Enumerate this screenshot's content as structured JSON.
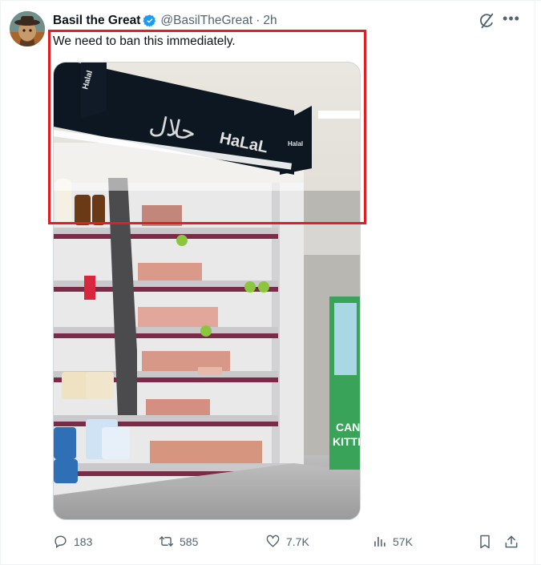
{
  "tweet": {
    "author_name": "Basil the Great",
    "handle": "@BasilTheGreat",
    "separator": "·",
    "time": "2h",
    "text": "We need to ban this immediately.",
    "verified": true
  },
  "media": {
    "sign_arabic": "حلال",
    "sign_main": "HaLaL",
    "sign_small": "Halal",
    "box_text": "CAN\nKITTE"
  },
  "actions": {
    "replies": "183",
    "reposts": "585",
    "likes": "7.7K",
    "views": "57K"
  },
  "colors": {
    "verified_badge": "#1d9bf0",
    "highlight_border": "#e02020",
    "muted_text": "#536471"
  }
}
